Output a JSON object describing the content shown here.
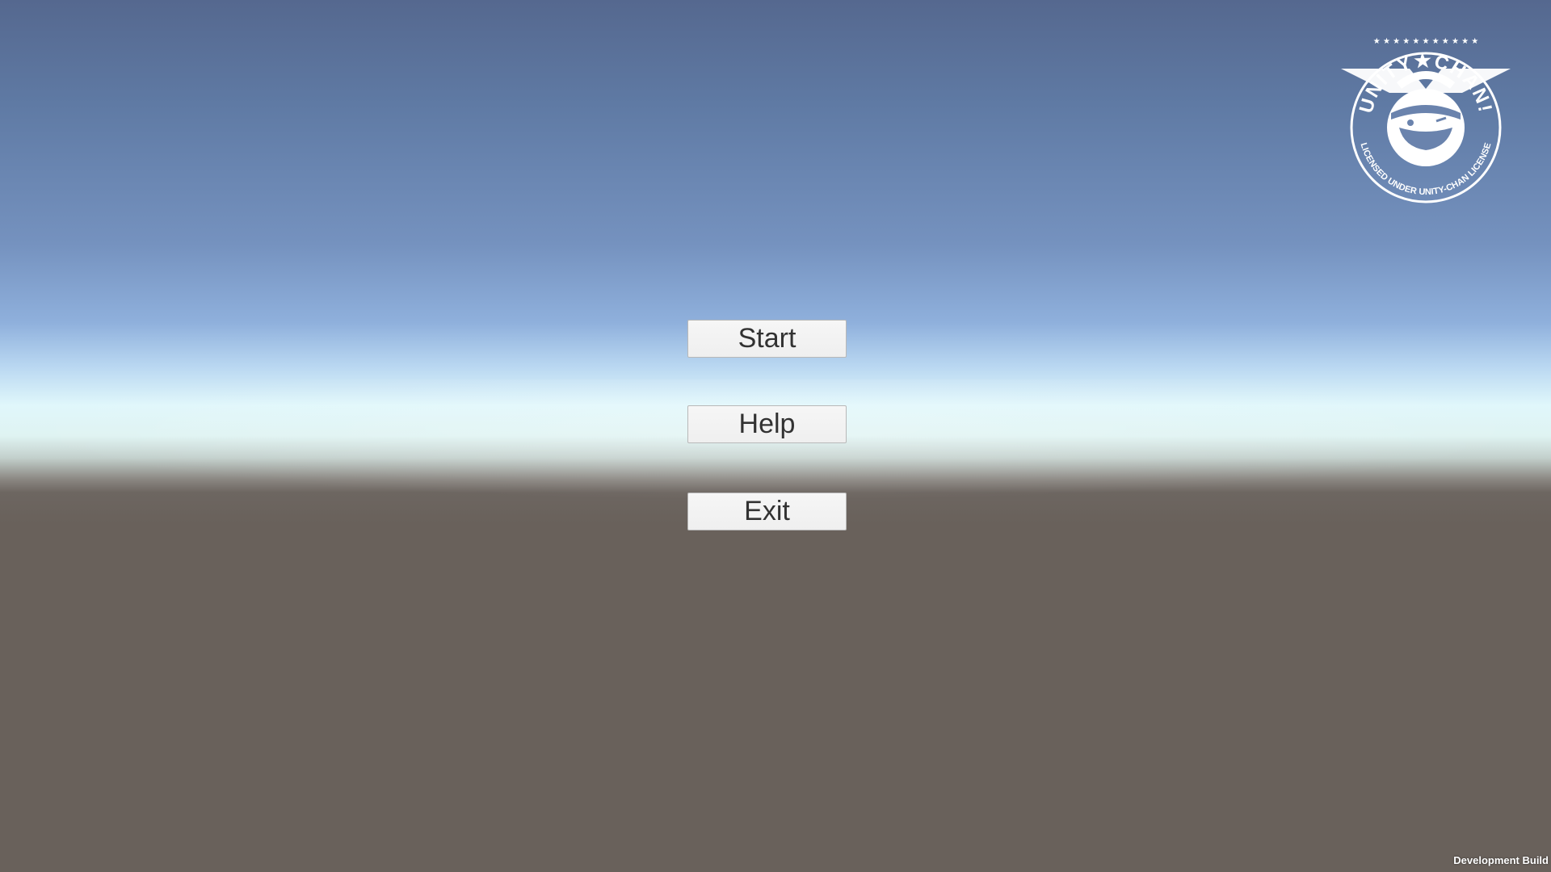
{
  "menu": {
    "start_label": "Start",
    "help_label": "Help",
    "exit_label": "Exit"
  },
  "logo": {
    "name": "unity-chan-license-logo",
    "text_top": "UNITY★CHAN!",
    "text_bottom": "LICENSED UNDER UNITY-CHAN LICENSE"
  },
  "footer": {
    "build_label": "Development Build"
  },
  "colors": {
    "sky_top": "#55688f",
    "horizon": "#e0f7fb",
    "ground": "#69615b",
    "button_bg": "#f0f0f0",
    "button_text": "#323232"
  }
}
